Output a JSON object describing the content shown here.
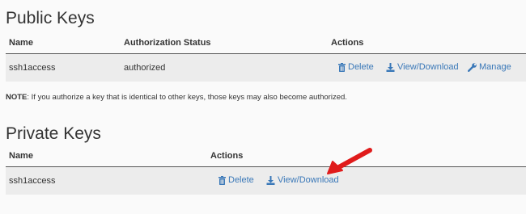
{
  "public_keys": {
    "title": "Public Keys",
    "columns": [
      "Name",
      "Authorization Status",
      "Actions"
    ],
    "rows": [
      {
        "name": "ssh1access",
        "status": "authorized",
        "actions": {
          "delete": "Delete",
          "view": "View/Download",
          "manage": "Manage"
        }
      }
    ]
  },
  "note": {
    "label": "NOTE",
    "text": ": If you authorize a key that is identical to other keys, those keys may also become authorized."
  },
  "private_keys": {
    "title": "Private Keys",
    "columns": [
      "Name",
      "Actions"
    ],
    "rows": [
      {
        "name": "ssh1access",
        "actions": {
          "delete": "Delete",
          "view": "View/Download"
        }
      }
    ]
  },
  "annotation": {
    "color": "#e01b1b",
    "icon": "red-arrow-icon"
  },
  "colors": {
    "link": "#3a78b8",
    "row_bg": "#ececec",
    "page_bg": "#fafafa"
  }
}
